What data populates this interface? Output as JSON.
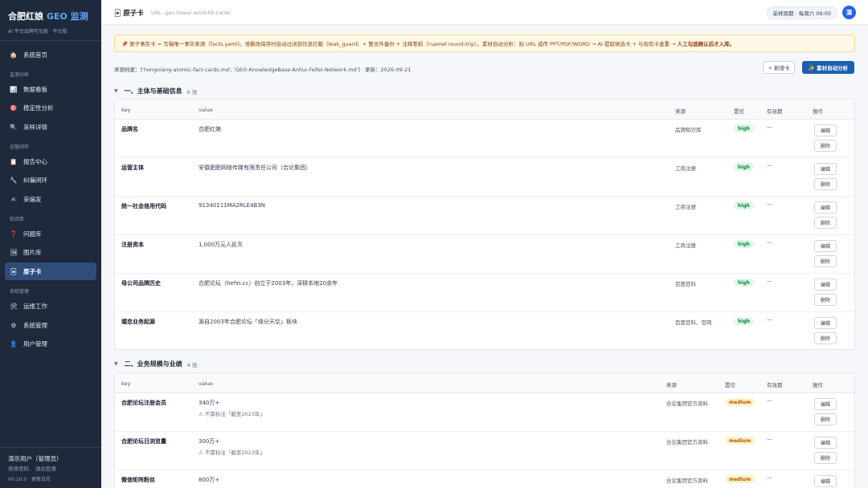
{
  "sidebar": {
    "brand_main": "合肥红娘",
    "brand_geo": "GEO 监测",
    "subtitle": "AI 平台品牌可见度 · 平台版",
    "home": {
      "label": "系统首页",
      "icon": "🏠"
    },
    "groups": [
      {
        "title": "监测分析",
        "items": [
          {
            "label": "数据看板",
            "icon": "📊"
          },
          {
            "label": "稳定性分析",
            "icon": "🎯"
          },
          {
            "label": "采样详情",
            "icon": "🔍"
          }
        ]
      },
      {
        "title": "运营闭环",
        "items": [
          {
            "label": "报告中心",
            "icon": "📋"
          },
          {
            "label": "纠偏闭环",
            "icon": "🔧"
          },
          {
            "label": "采编发",
            "icon": "✍"
          }
        ]
      },
      {
        "title": "知识库",
        "items": [
          {
            "label": "问题库",
            "icon": "❓"
          },
          {
            "label": "图片库",
            "icon": "🖼"
          },
          {
            "label": "原子卡",
            "icon": "🃏"
          }
        ]
      },
      {
        "title": "系统管理",
        "items": [
          {
            "label": "运维工作",
            "icon": "🛠"
          },
          {
            "label": "系统管理",
            "icon": "⚙"
          },
          {
            "label": "用户管理",
            "icon": "👤"
          }
        ]
      }
    ],
    "active_item": "原子卡",
    "user": "演示用户（管理员）",
    "change_password": "修改密码",
    "logout": "退出登录",
    "version": "V0.10.0 · 更新日志"
  },
  "header": {
    "icon": "🃏",
    "title": "原子卡",
    "url": "URL: geo.howai.work/kb-cards",
    "schedule": "采样周期 · 每周六 09:00",
    "avatar": "演"
  },
  "banner": {
    "text": "📌 原子事实卡 = 写稿唯一事实来源（facts.yaml)。增删改保存时自动过闭部信息拦截（leak_guard）+ 整文件备份 + 注释零损（ruamel round-trip）。素材自动分析：贴 URL 或传 PPT/PDF/WORD → AI 提取候选卡 + 与现有卡查重 →",
    "bold": "人工勾选确认后才入库。"
  },
  "source_line": "来源档案：['hongniang-atomic-fact-cards.md', 'GEO-KnowledgeBase-Anhui-Feifei-Network.md'] · 更新：2026-09-21",
  "actions": {
    "new_card": "+ 新增卡",
    "auto_analyze": "✨ 素材自动分析"
  },
  "columns": {
    "key": "key",
    "value": "value",
    "source": "来源",
    "confidence": "置信",
    "expiry": "有效期",
    "ops": "操作"
  },
  "ops": {
    "edit": "编辑",
    "delete": "删除"
  },
  "sections": [
    {
      "title": "一、主体与基础信息",
      "count": "6 张",
      "rows": [
        {
          "key": "品牌名",
          "value": "合肥红娘",
          "note": "",
          "source": "品牌知识库",
          "confidence": "high",
          "expiry": "—"
        },
        {
          "key": "运营主体",
          "value": "安徽肥肥网络传媒有限责任公司（合论集团）",
          "note": "",
          "source": "工商注册",
          "confidence": "high",
          "expiry": "—"
        },
        {
          "key": "统一社会信用代码",
          "value": "91340111MA2RLE4B3N",
          "note": "",
          "source": "工商注册",
          "confidence": "high",
          "expiry": "—"
        },
        {
          "key": "注册资本",
          "value": "1,000万元人民币",
          "note": "",
          "source": "工商注册",
          "confidence": "high",
          "expiry": "—"
        },
        {
          "key": "母公司品牌历史",
          "value": "合肥论坛（hefei.cc）创立于2003年，深耕本地20余年",
          "note": "",
          "source": "百度百科",
          "confidence": "high",
          "expiry": "—"
        },
        {
          "key": "婚恋业务起源",
          "value": "源自2003年合肥论坛「缘分天空」板块",
          "note": "",
          "source": "百度百科、官网",
          "confidence": "high",
          "expiry": "—"
        }
      ]
    },
    {
      "title": "二、业务规模与业绩",
      "count": "4 张",
      "rows": [
        {
          "key": "合肥论坛注册会员",
          "value": "340万+",
          "note": "⚠ 不需标注「截至2023年」",
          "source": "合论集团官方资料",
          "confidence": "medium",
          "expiry": "—"
        },
        {
          "key": "合肥论坛日浏览量",
          "value": "300万+",
          "note": "⚠ 不需标注「截至2023年」",
          "source": "合论集团官方资料",
          "confidence": "medium",
          "expiry": "—"
        },
        {
          "key": "微信矩阵粉丝",
          "value": "800万+",
          "note": "",
          "source": "合论集团官方资料",
          "confidence": "medium",
          "expiry": "—"
        }
      ]
    }
  ]
}
